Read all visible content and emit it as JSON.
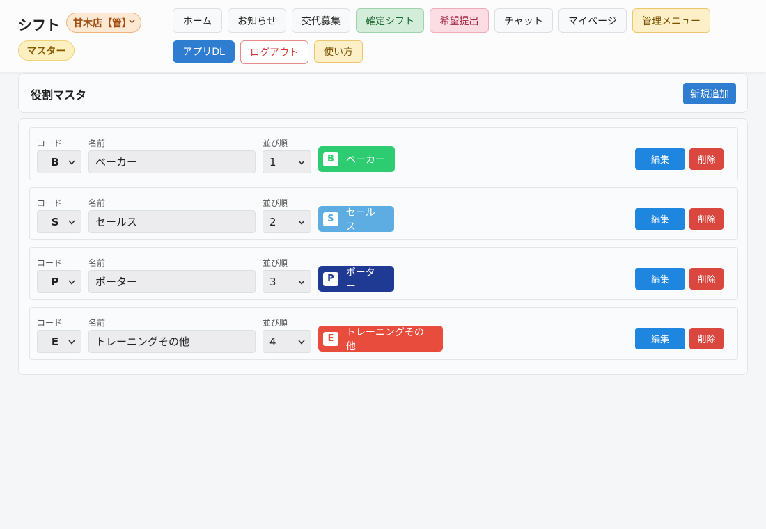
{
  "header": {
    "brand": "シフト",
    "store_select": "甘木店【管】",
    "role_badge": "マスター",
    "nav": {
      "home": "ホーム",
      "news": "お知らせ",
      "swap": "交代募集",
      "confirmed": "確定シフト",
      "request": "希望提出",
      "chat": "チャット",
      "mypage": "マイページ",
      "admin": "管理メニュー",
      "app_dl": "アプリDL",
      "logout": "ログアウト",
      "howto": "使い方"
    }
  },
  "page": {
    "title": "役割マスタ",
    "add_button": "新規追加"
  },
  "labels": {
    "code": "コード",
    "name": "名前",
    "order": "並び順",
    "edit": "編集",
    "delete": "削除"
  },
  "roles": [
    {
      "code": "B",
      "name": "ベーカー",
      "order": "1",
      "color": "#2ecc71"
    },
    {
      "code": "S",
      "name": "セールス",
      "order": "2",
      "color": "#5dade2"
    },
    {
      "code": "P",
      "name": "ポーター",
      "order": "3",
      "color": "#1f3a93"
    },
    {
      "code": "E",
      "name": "トレーニングその他",
      "order": "4",
      "color": "#e74c3c"
    }
  ]
}
